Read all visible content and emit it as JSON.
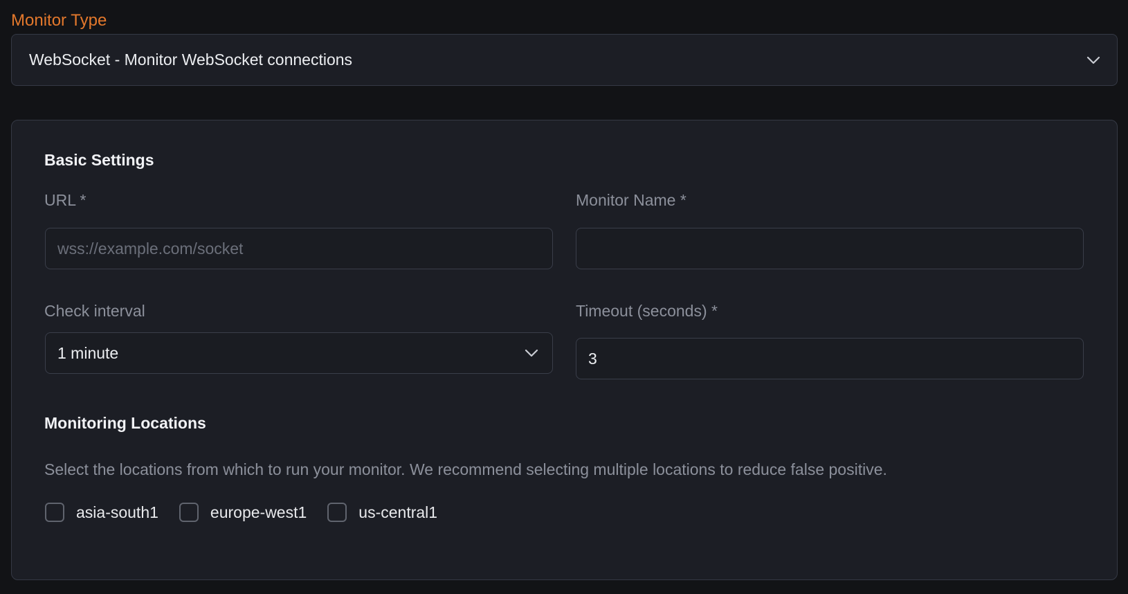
{
  "monitor_type": {
    "label": "Monitor Type",
    "selected": "WebSocket - Monitor WebSocket connections",
    "icon": "chevron-down-icon"
  },
  "basic_settings": {
    "title": "Basic Settings",
    "url": {
      "label": "URL *",
      "value": "",
      "placeholder": "wss://example.com/socket"
    },
    "monitor_name": {
      "label": "Monitor Name *",
      "value": "",
      "placeholder": ""
    },
    "check_interval": {
      "label": "Check interval",
      "selected": "1 minute",
      "icon": "chevron-down-icon"
    },
    "timeout": {
      "label": "Timeout (seconds) *",
      "value": "3"
    }
  },
  "monitoring_locations": {
    "title": "Monitoring Locations",
    "description": "Select the locations from which to run your monitor. We recommend selecting multiple locations to reduce false positive.",
    "locations": [
      {
        "label": "asia-south1",
        "checked": false
      },
      {
        "label": "europe-west1",
        "checked": false
      },
      {
        "label": "us-central1",
        "checked": false
      }
    ]
  },
  "colors": {
    "background": "#121316",
    "panel": "#1c1e25",
    "accent_label": "#e3782c",
    "border": "#353945",
    "muted_text": "#8c909b"
  }
}
